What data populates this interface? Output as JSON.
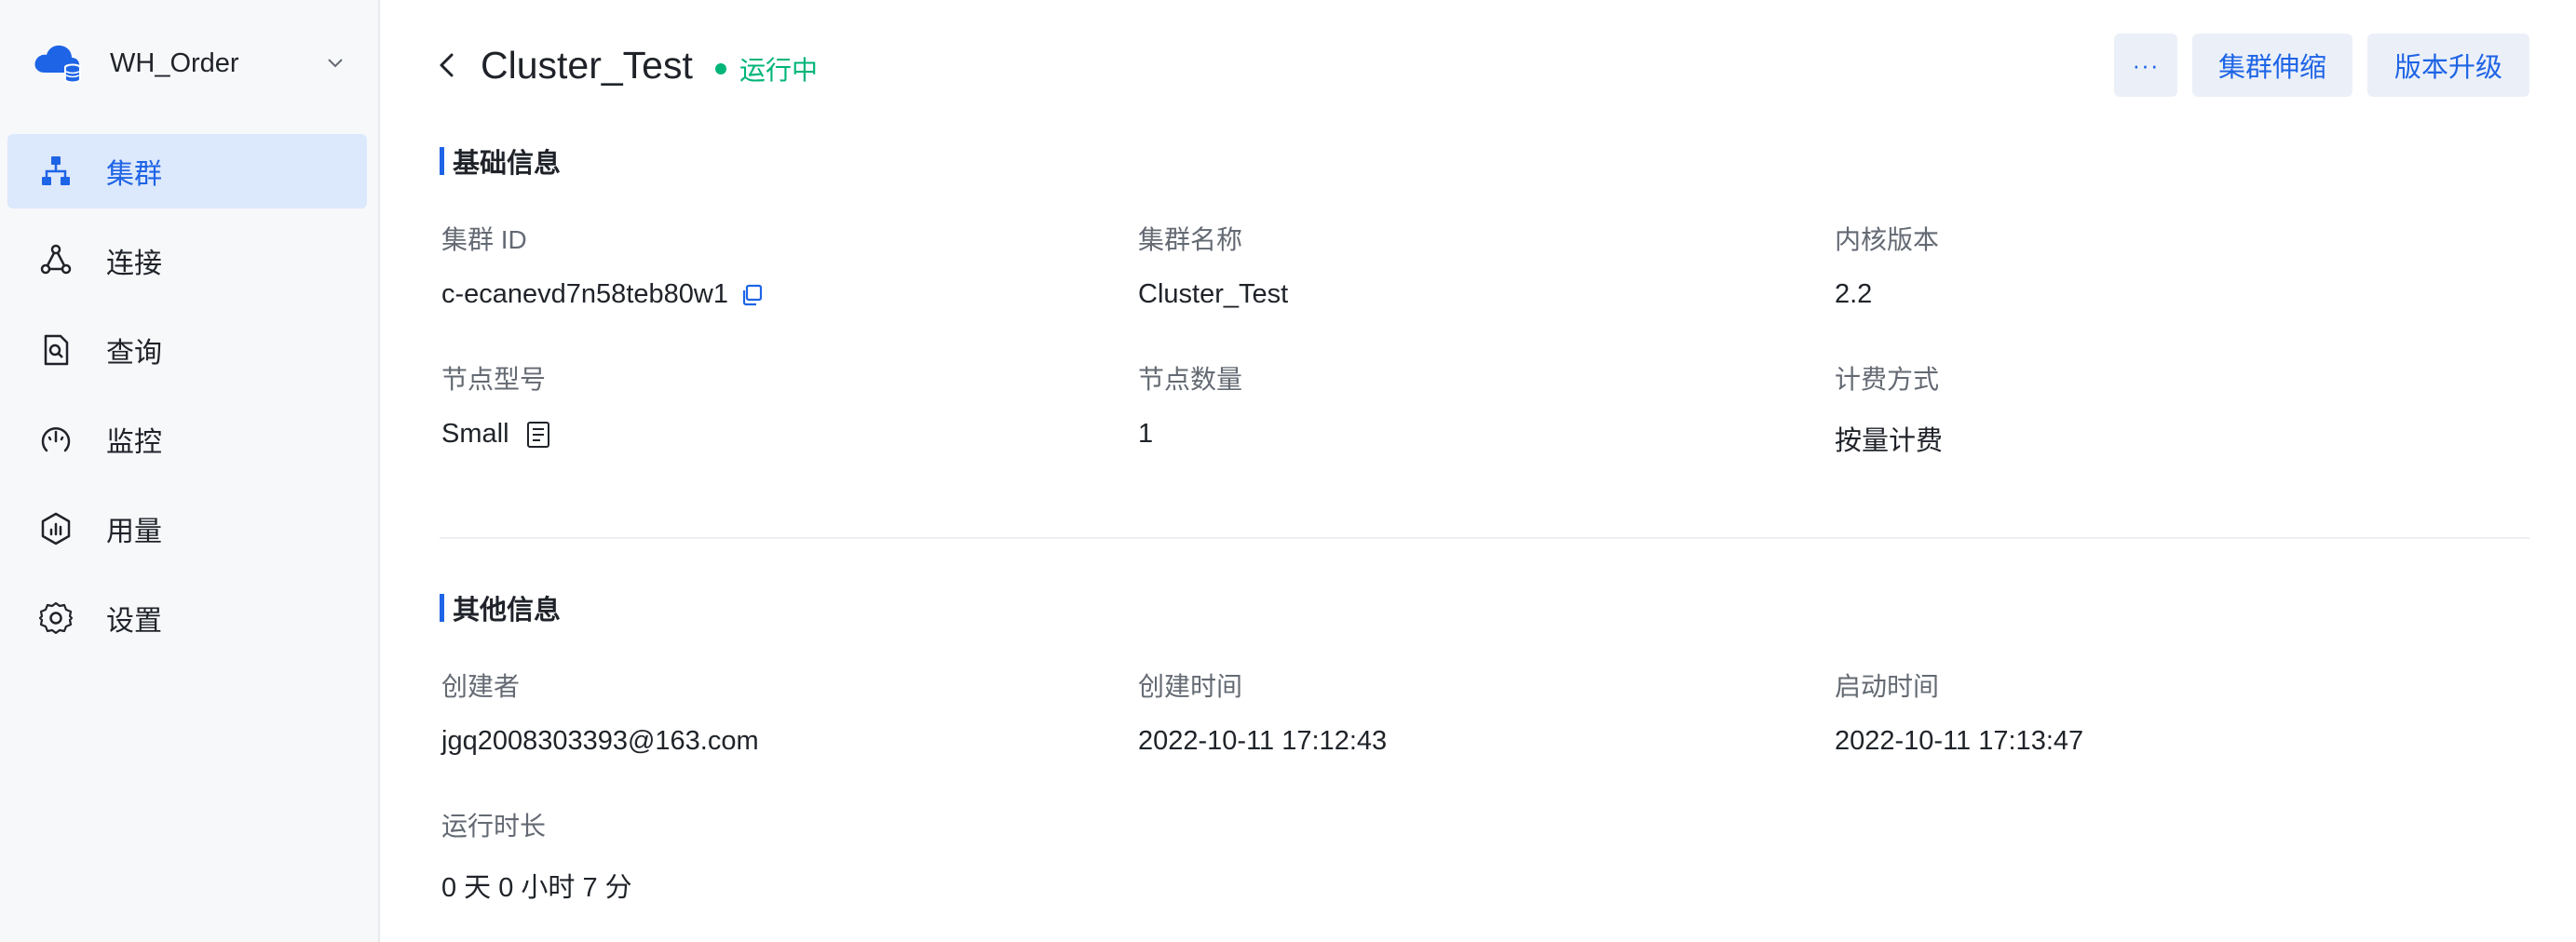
{
  "workspace": {
    "name": "WH_Order"
  },
  "nav": {
    "items": [
      {
        "label": "集群",
        "icon": "cluster-icon",
        "active": true
      },
      {
        "label": "连接",
        "icon": "connection-icon",
        "active": false
      },
      {
        "label": "查询",
        "icon": "query-icon",
        "active": false
      },
      {
        "label": "监控",
        "icon": "monitor-icon",
        "active": false
      },
      {
        "label": "用量",
        "icon": "usage-icon",
        "active": false
      },
      {
        "label": "设置",
        "icon": "gear-icon",
        "active": false
      }
    ]
  },
  "header": {
    "title": "Cluster_Test",
    "status": "运行中",
    "more_label": "···",
    "scale_label": "集群伸缩",
    "upgrade_label": "版本升级"
  },
  "basic": {
    "title": "基础信息",
    "cluster_id": {
      "label": "集群 ID",
      "value": "c-ecanevd7n58teb80w1"
    },
    "cluster_name": {
      "label": "集群名称",
      "value": "Cluster_Test"
    },
    "kernel_version": {
      "label": "内核版本",
      "value": "2.2"
    },
    "node_type": {
      "label": "节点型号",
      "value": "Small"
    },
    "node_count": {
      "label": "节点数量",
      "value": "1"
    },
    "billing": {
      "label": "计费方式",
      "value": "按量计费"
    }
  },
  "other": {
    "title": "其他信息",
    "creator": {
      "label": "创建者",
      "value": "jgq2008303393@163.com"
    },
    "created_at": {
      "label": "创建时间",
      "value": "2022-10-11 17:12:43"
    },
    "started_at": {
      "label": "启动时间",
      "value": "2022-10-11 17:13:47"
    },
    "uptime": {
      "label": "运行时长",
      "value": "0 天 0 小时 7 分"
    }
  },
  "colors": {
    "accent": "#1e64e6",
    "running": "#00b578",
    "active_bg": "#dce8fc"
  }
}
